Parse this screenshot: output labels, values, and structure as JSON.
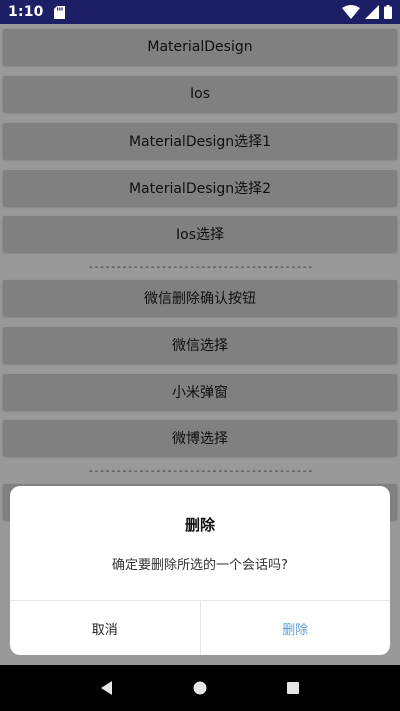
{
  "status_bar": {
    "time": "1:10",
    "icons": [
      "sd-card-icon",
      "wifi-icon",
      "signal-icon",
      "battery-icon"
    ]
  },
  "buttons": [
    {
      "label": "MaterialDesign"
    },
    {
      "label": "Ios"
    },
    {
      "label": "MaterialDesign选择1"
    },
    {
      "label": "MaterialDesign选择2"
    },
    {
      "label": "Ios选择"
    }
  ],
  "divider_1": "----------------------------------------",
  "buttons_2": [
    {
      "label": "微信删除确认按钮"
    },
    {
      "label": "微信选择"
    },
    {
      "label": "小米弹窗"
    },
    {
      "label": "微博选择"
    }
  ],
  "divider_2": "----------------------------------------",
  "dialog": {
    "title": "删除",
    "message": "确定要删除所选的一个会话吗?",
    "cancel_label": "取消",
    "confirm_label": "删除"
  },
  "nav_bar": {
    "icons": [
      "back-icon",
      "home-icon",
      "recents-icon"
    ]
  },
  "colors": {
    "status_bar": "#1c1f66",
    "button_bg": "#d6d6d6",
    "confirm_text": "#5b9bd5"
  }
}
